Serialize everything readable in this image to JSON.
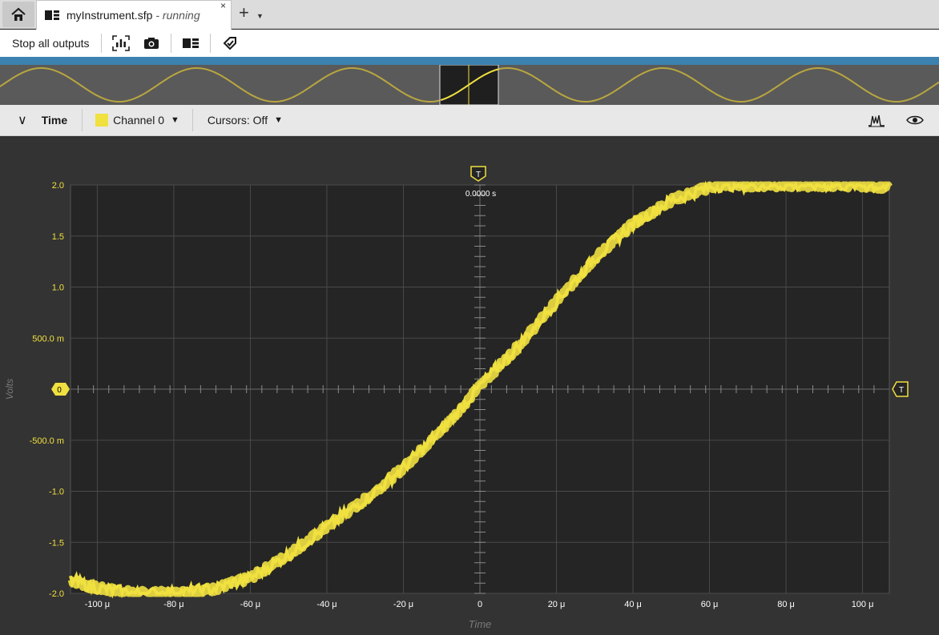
{
  "tabs": {
    "doc_name": "myInstrument.sfp",
    "doc_status": "- running",
    "close_glyph": "×",
    "new_tab_glyph": "+",
    "new_tab_menu_glyph": "▼"
  },
  "toolbar": {
    "stop_label": "Stop all outputs"
  },
  "graph_header": {
    "collapse_glyph": "∨",
    "title": "Time",
    "channel_label": "Channel 0",
    "channel_color": "#f0e040",
    "dropdown_glyph": "▼",
    "cursors_label": "Cursors: Off"
  },
  "trigger": {
    "marker_label": "T",
    "time_readout": "0.0000 s",
    "level_marker_label": "T"
  },
  "channel_marker_label": "0",
  "icons": {
    "home": "home-icon",
    "instrument": "instrument-icon",
    "capture": "capture-icon",
    "camera": "camera-icon",
    "layout": "layout-icon",
    "tag": "tag-icon",
    "spectrum": "spectrum-icon",
    "visibility": "eye-icon"
  },
  "colors": {
    "trace": "#f0e040",
    "accent": "#3b82b0",
    "plot_bg": "#252525",
    "axis_text": "#f0e040",
    "tick_text": "#ffffff"
  },
  "chart_data": {
    "type": "line",
    "xlabel": "Time",
    "ylabel": "Volts",
    "xlim": [
      -107,
      107
    ],
    "ylim": [
      -2.0,
      2.0
    ],
    "x_ticks": [
      "-100 μ",
      "-80 μ",
      "-60 μ",
      "-40 μ",
      "-20 μ",
      "0",
      "20 μ",
      "40 μ",
      "60 μ",
      "80 μ",
      "100 μ"
    ],
    "x_tick_values": [
      -100,
      -80,
      -60,
      -40,
      -20,
      0,
      20,
      40,
      60,
      80,
      100
    ],
    "y_ticks": [
      "2.0",
      "1.5",
      "1.0",
      "500.0 m",
      "0",
      "-500.0 m",
      "-1.0",
      "-1.5",
      "-2.0"
    ],
    "y_tick_values": [
      2.0,
      1.5,
      1.0,
      0.5,
      0.0,
      -0.5,
      -1.0,
      -1.5,
      -2.0
    ],
    "grid": true,
    "series": [
      {
        "name": "Channel 0",
        "x": [
          -107,
          -100,
          -90,
          -80,
          -70,
          -60,
          -50,
          -40,
          -30,
          -20,
          -10,
          0,
          10,
          20,
          30,
          40,
          50,
          60,
          64,
          70,
          80,
          90,
          100,
          107
        ],
        "y": [
          -1.87,
          -1.95,
          -2.0,
          -2.0,
          -1.96,
          -1.85,
          -1.62,
          -1.35,
          -1.08,
          -0.77,
          -0.4,
          0.03,
          0.42,
          0.86,
          1.28,
          1.62,
          1.85,
          1.98,
          2.0,
          2.0,
          2.0,
          2.0,
          2.0,
          1.98
        ]
      }
    ],
    "trigger_time": "0.0000 s"
  }
}
